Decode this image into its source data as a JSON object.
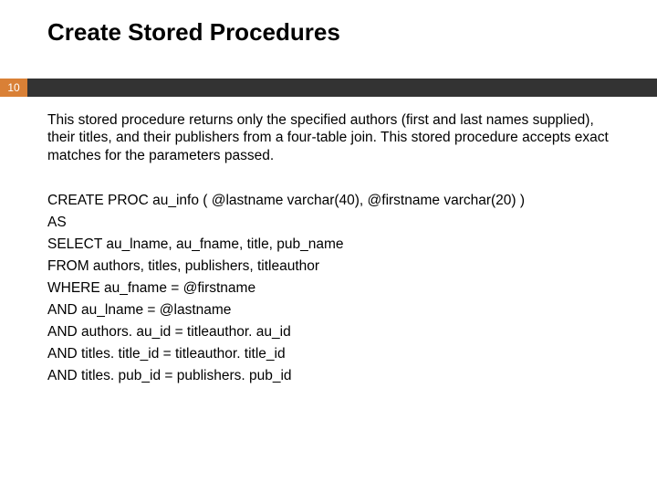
{
  "title": "Create Stored Procedures",
  "page_number": "10",
  "description": "This stored procedure returns only the specified authors (first and last names supplied), their titles, and their publishers from a four-table join. This stored procedure accepts exact matches for the parameters passed.",
  "code": {
    "l1": "CREATE PROC au_info ( @lastname varchar(40), @firstname varchar(20) )",
    "l2": "AS",
    "l3": "SELECT au_lname, au_fname, title, pub_name",
    "l4": "FROM authors, titles, publishers, titleauthor",
    "l5": "WHERE au_fname = @firstname",
    "l6": "AND au_lname = @lastname",
    "l7": "AND authors. au_id = titleauthor. au_id",
    "l8": "AND titles. title_id = titleauthor. title_id",
    "l9": "AND titles. pub_id = publishers. pub_id"
  }
}
